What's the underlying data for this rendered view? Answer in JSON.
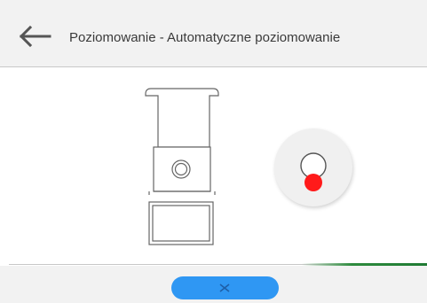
{
  "header": {
    "back_icon": "arrow-left-icon",
    "title": "Poziomowanie - Automatyczne poziomowanie"
  },
  "main": {
    "scale_icon": "scale-illustration",
    "level_indicator": {
      "icon": "bubble-level-icon",
      "bubble_color": "#ff1a1a",
      "status": "not-level"
    }
  },
  "progress": {
    "value": 0.3,
    "color": "#2e8b3e"
  },
  "footer": {
    "cancel_icon": "close-x-icon",
    "button_color": "#2f97f3"
  }
}
